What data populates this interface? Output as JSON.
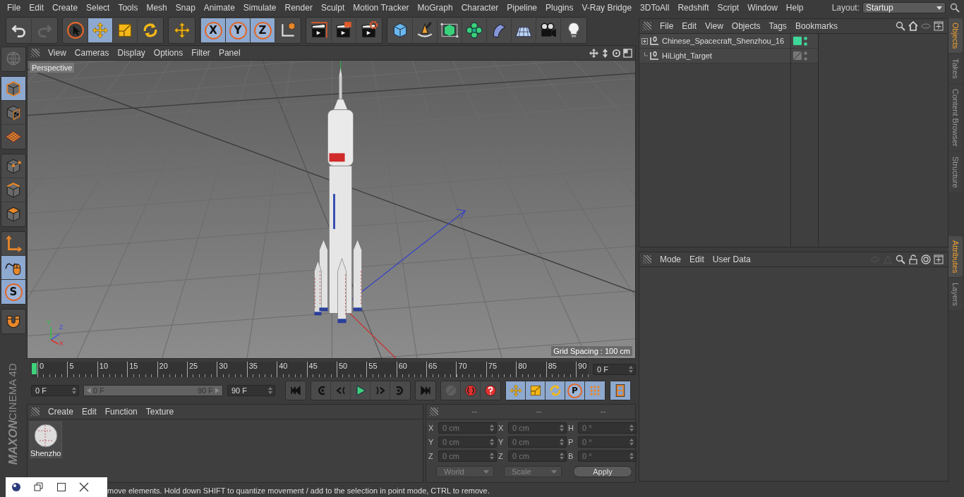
{
  "menu_bar": {
    "items": [
      "File",
      "Edit",
      "Create",
      "Select",
      "Tools",
      "Mesh",
      "Snap",
      "Animate",
      "Simulate",
      "Render",
      "Sculpt",
      "Motion Tracker",
      "MoGraph",
      "Character",
      "Pipeline",
      "Plugins",
      "V-Ray Bridge",
      "3DToAll",
      "Redshift",
      "Script",
      "Window",
      "Help"
    ],
    "layout_label": "Layout:",
    "layout_value": "Startup"
  },
  "toolbar": {
    "groups": [
      {
        "buttons": [
          {
            "kind": "undo",
            "selected": false,
            "disabled": false
          },
          {
            "kind": "redo",
            "selected": false,
            "disabled": true
          }
        ]
      },
      {
        "buttons": [
          {
            "kind": "select",
            "selected": false,
            "disabled": false
          },
          {
            "kind": "move",
            "selected": true,
            "disabled": false
          },
          {
            "kind": "scale",
            "selected": false,
            "disabled": false
          },
          {
            "kind": "rotate",
            "selected": false,
            "disabled": false
          }
        ]
      },
      {
        "buttons": [
          {
            "kind": "move",
            "selected": false,
            "disabled": false
          }
        ]
      },
      {
        "buttons": [
          {
            "kind": "axis-lock",
            "label": "X",
            "selected": true,
            "disabled": false
          },
          {
            "kind": "axis-lock",
            "label": "Y",
            "selected": true,
            "disabled": false
          },
          {
            "kind": "axis-lock",
            "label": "Z",
            "selected": true,
            "disabled": false
          },
          {
            "kind": "coord",
            "selected": false,
            "disabled": false
          }
        ]
      },
      {
        "buttons": [
          {
            "kind": "render-view",
            "selected": false,
            "disabled": false
          },
          {
            "kind": "render-picture",
            "selected": false,
            "disabled": false
          },
          {
            "kind": "render-settings",
            "selected": false,
            "disabled": false
          }
        ]
      },
      {
        "buttons": [
          {
            "kind": "cube",
            "selected": false,
            "disabled": false
          },
          {
            "kind": "pen",
            "selected": false,
            "disabled": false
          },
          {
            "kind": "subdivision",
            "selected": false,
            "disabled": false
          },
          {
            "kind": "cloner",
            "selected": false,
            "disabled": false
          },
          {
            "kind": "deformer",
            "selected": false,
            "disabled": false
          },
          {
            "kind": "floor",
            "selected": false,
            "disabled": false
          },
          {
            "kind": "camera",
            "selected": false,
            "disabled": false
          },
          {
            "kind": "light",
            "selected": false,
            "disabled": false
          }
        ]
      }
    ]
  },
  "left_toolbar": {
    "groups": [
      {
        "buttons": [
          {
            "kind": "globe",
            "selected": false,
            "disabled": true
          }
        ]
      },
      {
        "buttons": [
          {
            "kind": "model",
            "selected": true,
            "disabled": false
          },
          {
            "kind": "texture",
            "selected": false,
            "disabled": false
          },
          {
            "kind": "workplane",
            "selected": false,
            "disabled": false
          }
        ]
      },
      {
        "buttons": [
          {
            "kind": "points",
            "selected": false,
            "disabled": false
          },
          {
            "kind": "edges",
            "selected": false,
            "disabled": false
          },
          {
            "kind": "polygons",
            "selected": false,
            "disabled": false
          }
        ]
      },
      {
        "buttons": [
          {
            "kind": "axis",
            "selected": false,
            "disabled": false
          },
          {
            "kind": "tweak",
            "selected": true,
            "disabled": false
          },
          {
            "kind": "snap",
            "label": "S",
            "selected": true,
            "disabled": false
          }
        ]
      },
      {
        "buttons": [
          {
            "kind": "magnet",
            "selected": false,
            "disabled": false
          }
        ]
      }
    ]
  },
  "logo": {
    "lines": [
      "MAXON",
      "CINEMA 4D"
    ]
  },
  "viewport": {
    "menu": [
      "View",
      "Cameras",
      "Display",
      "Options",
      "Filter",
      "Panel"
    ],
    "camera_label": "Perspective",
    "grid_info": "Grid Spacing : 100 cm",
    "gizmo_labels": [
      "Y",
      "Z",
      "X"
    ]
  },
  "timeline": {
    "ticks": [
      "0",
      "5",
      "10",
      "15",
      "20",
      "25",
      "30",
      "35",
      "40",
      "45",
      "50",
      "55",
      "60",
      "65",
      "70",
      "75",
      "80",
      "85",
      "90"
    ],
    "playhead": {
      "level": 0
    },
    "current_frame": "0 F"
  },
  "transport": {
    "start_field": "0 F",
    "range": {
      "start": "0 F",
      "end": "90 F",
      "level": 1
    },
    "end_field": "90 F",
    "groups": [
      {
        "buttons": [
          {
            "kind": "go-start",
            "selected": false,
            "disabled": false
          }
        ]
      },
      {
        "buttons": [
          {
            "kind": "prev-key",
            "selected": false,
            "disabled": false
          },
          {
            "kind": "prev-frame",
            "selected": false,
            "disabled": false
          },
          {
            "kind": "play",
            "selected": false,
            "disabled": false
          },
          {
            "kind": "next-frame",
            "selected": false,
            "disabled": false
          },
          {
            "kind": "next-key",
            "selected": false,
            "disabled": false
          }
        ]
      },
      {
        "buttons": [
          {
            "kind": "go-end",
            "selected": false,
            "disabled": false
          }
        ]
      },
      {
        "buttons": [
          {
            "kind": "motion-path",
            "selected": false,
            "disabled": true
          },
          {
            "kind": "record",
            "selected": false,
            "disabled": false
          },
          {
            "kind": "autokey",
            "selected": false,
            "disabled": false
          }
        ]
      },
      {
        "buttons": [
          {
            "kind": "move",
            "selected": true,
            "disabled": false
          },
          {
            "kind": "scale",
            "selected": true,
            "disabled": false
          },
          {
            "kind": "rotate",
            "selected": true,
            "disabled": false
          },
          {
            "kind": "param",
            "label": "P",
            "selected": true,
            "disabled": false
          },
          {
            "kind": "point-level",
            "selected": true,
            "disabled": false
          }
        ]
      },
      {
        "buttons": [
          {
            "kind": "film",
            "selected": true,
            "disabled": false
          }
        ]
      }
    ]
  },
  "material_manager": {
    "menu": [
      "Create",
      "Edit",
      "Function",
      "Texture"
    ],
    "materials": [
      {
        "name": "Shenzho"
      }
    ]
  },
  "coordinates": {
    "headers": [
      "--",
      "--",
      "--"
    ],
    "rows": [
      {
        "fields": [
          {
            "label": "X",
            "value": "0 cm"
          },
          {
            "label": "X",
            "value": "0 cm"
          },
          {
            "label": "H",
            "value": "0 °"
          }
        ]
      },
      {
        "fields": [
          {
            "label": "Y",
            "value": "0 cm"
          },
          {
            "label": "Y",
            "value": "0 cm"
          },
          {
            "label": "P",
            "value": "0 °"
          }
        ]
      },
      {
        "fields": [
          {
            "label": "Z",
            "value": "0 cm"
          },
          {
            "label": "Z",
            "value": "0 cm"
          },
          {
            "label": "B",
            "value": "0 °"
          }
        ]
      }
    ],
    "dropdowns": [
      "World",
      "Scale"
    ],
    "apply": "Apply"
  },
  "status_bar": {
    "text": "move elements. Hold down SHIFT to quantize movement / add to the selection in point mode, CTRL to remove."
  },
  "object_manager": {
    "menu": [
      "File",
      "Edit",
      "View",
      "Objects",
      "Tags",
      "Bookmarks"
    ],
    "objects": [
      {
        "name": "Chinese_Spacecraft_Shenzhou_16",
        "expanded": false,
        "enabled": true
      },
      {
        "name": "HiLight_Target",
        "enabled": false
      }
    ]
  },
  "attributes_manager": {
    "menu": [
      "Mode",
      "Edit",
      "User Data"
    ]
  },
  "side_tabs": [
    {
      "label": "Objects",
      "selected": true
    },
    {
      "label": "Takes",
      "selected": false
    },
    {
      "label": "Content Browser",
      "selected": false
    },
    {
      "label": "Structure",
      "selected": false
    }
  ],
  "side_tabs_lower": [
    {
      "label": "Attributes",
      "selected": true
    },
    {
      "label": "Layers",
      "selected": false
    }
  ]
}
